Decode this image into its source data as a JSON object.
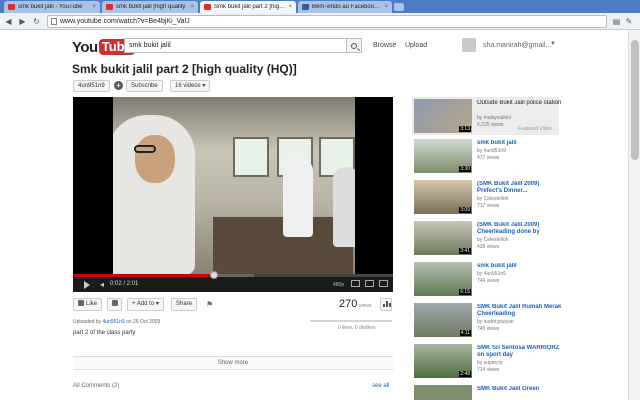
{
  "browser": {
    "tabs": [
      {
        "title": "smk bukit jalil - YouTube",
        "active": false
      },
      {
        "title": "smk bukit jalil [high quality",
        "active": false
      },
      {
        "title": "Smk bukit jalil part 2 [high q",
        "active": true
      },
      {
        "title": "Bem-vindo ao Facebook - o",
        "active": false
      }
    ],
    "url": "www.youtube.com/watch?v=Be4bjKi_VaU"
  },
  "header": {
    "logo_you": "You",
    "logo_tube": "Tube",
    "search_value": "smk bukit jalil",
    "browse": "Browse",
    "upload": "Upload",
    "username": "sha.manirah@gmail..."
  },
  "video": {
    "title": "Smk bukit jalil part 2 [high quality (HQ)]",
    "channel": "4un951n9",
    "subscribe": "Subscribe",
    "video_count": "16 videos",
    "time": "0:02 / 2:01",
    "quality": "480p",
    "progress": 0.44,
    "views": "270",
    "views_label": "views",
    "like": "Like",
    "add_to": "Add to",
    "share": "Share",
    "uploaded_prefix": "Uploaded by",
    "uploaded_by": "4un951n9",
    "uploaded_date": "on 26 Oct 2009",
    "likes_dislikes": "0 likes, 0 dislikes",
    "description": "part 2 of the class party",
    "show_more": "Show more",
    "comments_label": "All Comments (2)",
    "see_all": "see all"
  },
  "sidebar": [
    {
      "title": "Outside Bukit Jalil police station",
      "by": "by malaysiakini",
      "views": "6,225 views",
      "duration": "3:13",
      "featured": "Featured Video"
    },
    {
      "title": "smk bukit jalil",
      "by": "by 4un951n9",
      "views": "477 views",
      "duration": "3:30"
    },
    {
      "title": "(SMK Bukit Jalil 2009) Prefect's Dinner...",
      "by": "by Celestelloh",
      "views": "717 views",
      "duration": "3:09"
    },
    {
      "title": "(SMK Bukit Jalil 2009) Cheerleading done by",
      "by": "by Celestelloh",
      "views": "438 views",
      "duration": "3:41"
    },
    {
      "title": "smk bukit jalil",
      "by": "by 4un951n9",
      "views": "746 views",
      "duration": "6:15"
    },
    {
      "title": "SMK Bukit Jalil Rumah Merak Cheerleading",
      "by": "by audreypuiyan",
      "views": "745 views",
      "duration": "4:11"
    },
    {
      "title": "SMK Sri Sentosa WARRIORZ on sport day",
      "by": "by superyio",
      "views": "714 views",
      "duration": "2:48"
    },
    {
      "title": "SMK Bukit Jalil Green",
      "by": "",
      "views": "",
      "duration": ""
    }
  ]
}
